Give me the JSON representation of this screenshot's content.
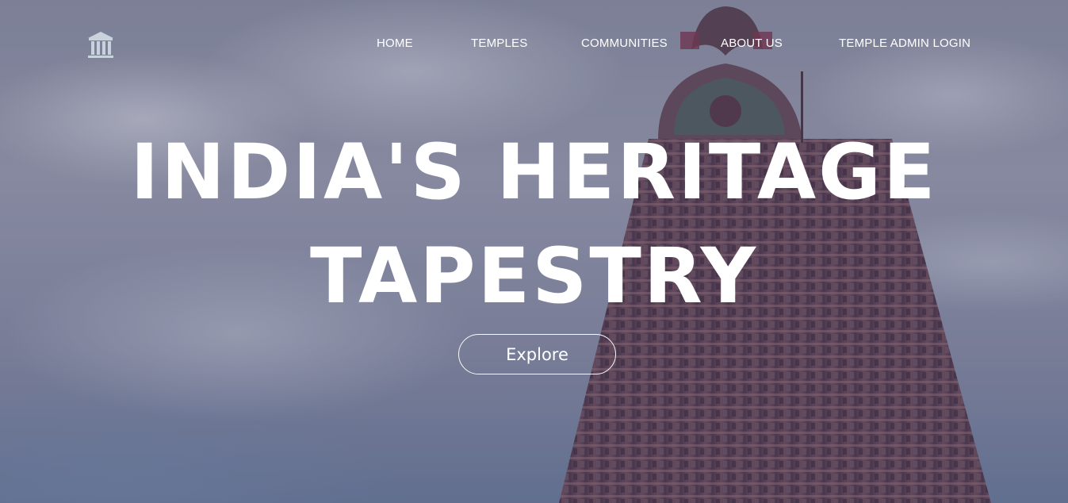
{
  "header": {
    "logo_icon": "temple-columns-icon",
    "nav": {
      "home": "HOME",
      "temples": "TEMPLES",
      "communities": "COMMUNITIES",
      "about": "ABOUT US",
      "admin_login": "TEMPLE ADMIN LOGIN"
    }
  },
  "hero": {
    "title_line1": "INDIA'S HERITAGE",
    "title_line2": "TAPESTRY",
    "cta_label": "Explore"
  },
  "colors": {
    "text": "#ffffff",
    "sky": "#8f93a8",
    "tower": "#6b4a5a"
  }
}
